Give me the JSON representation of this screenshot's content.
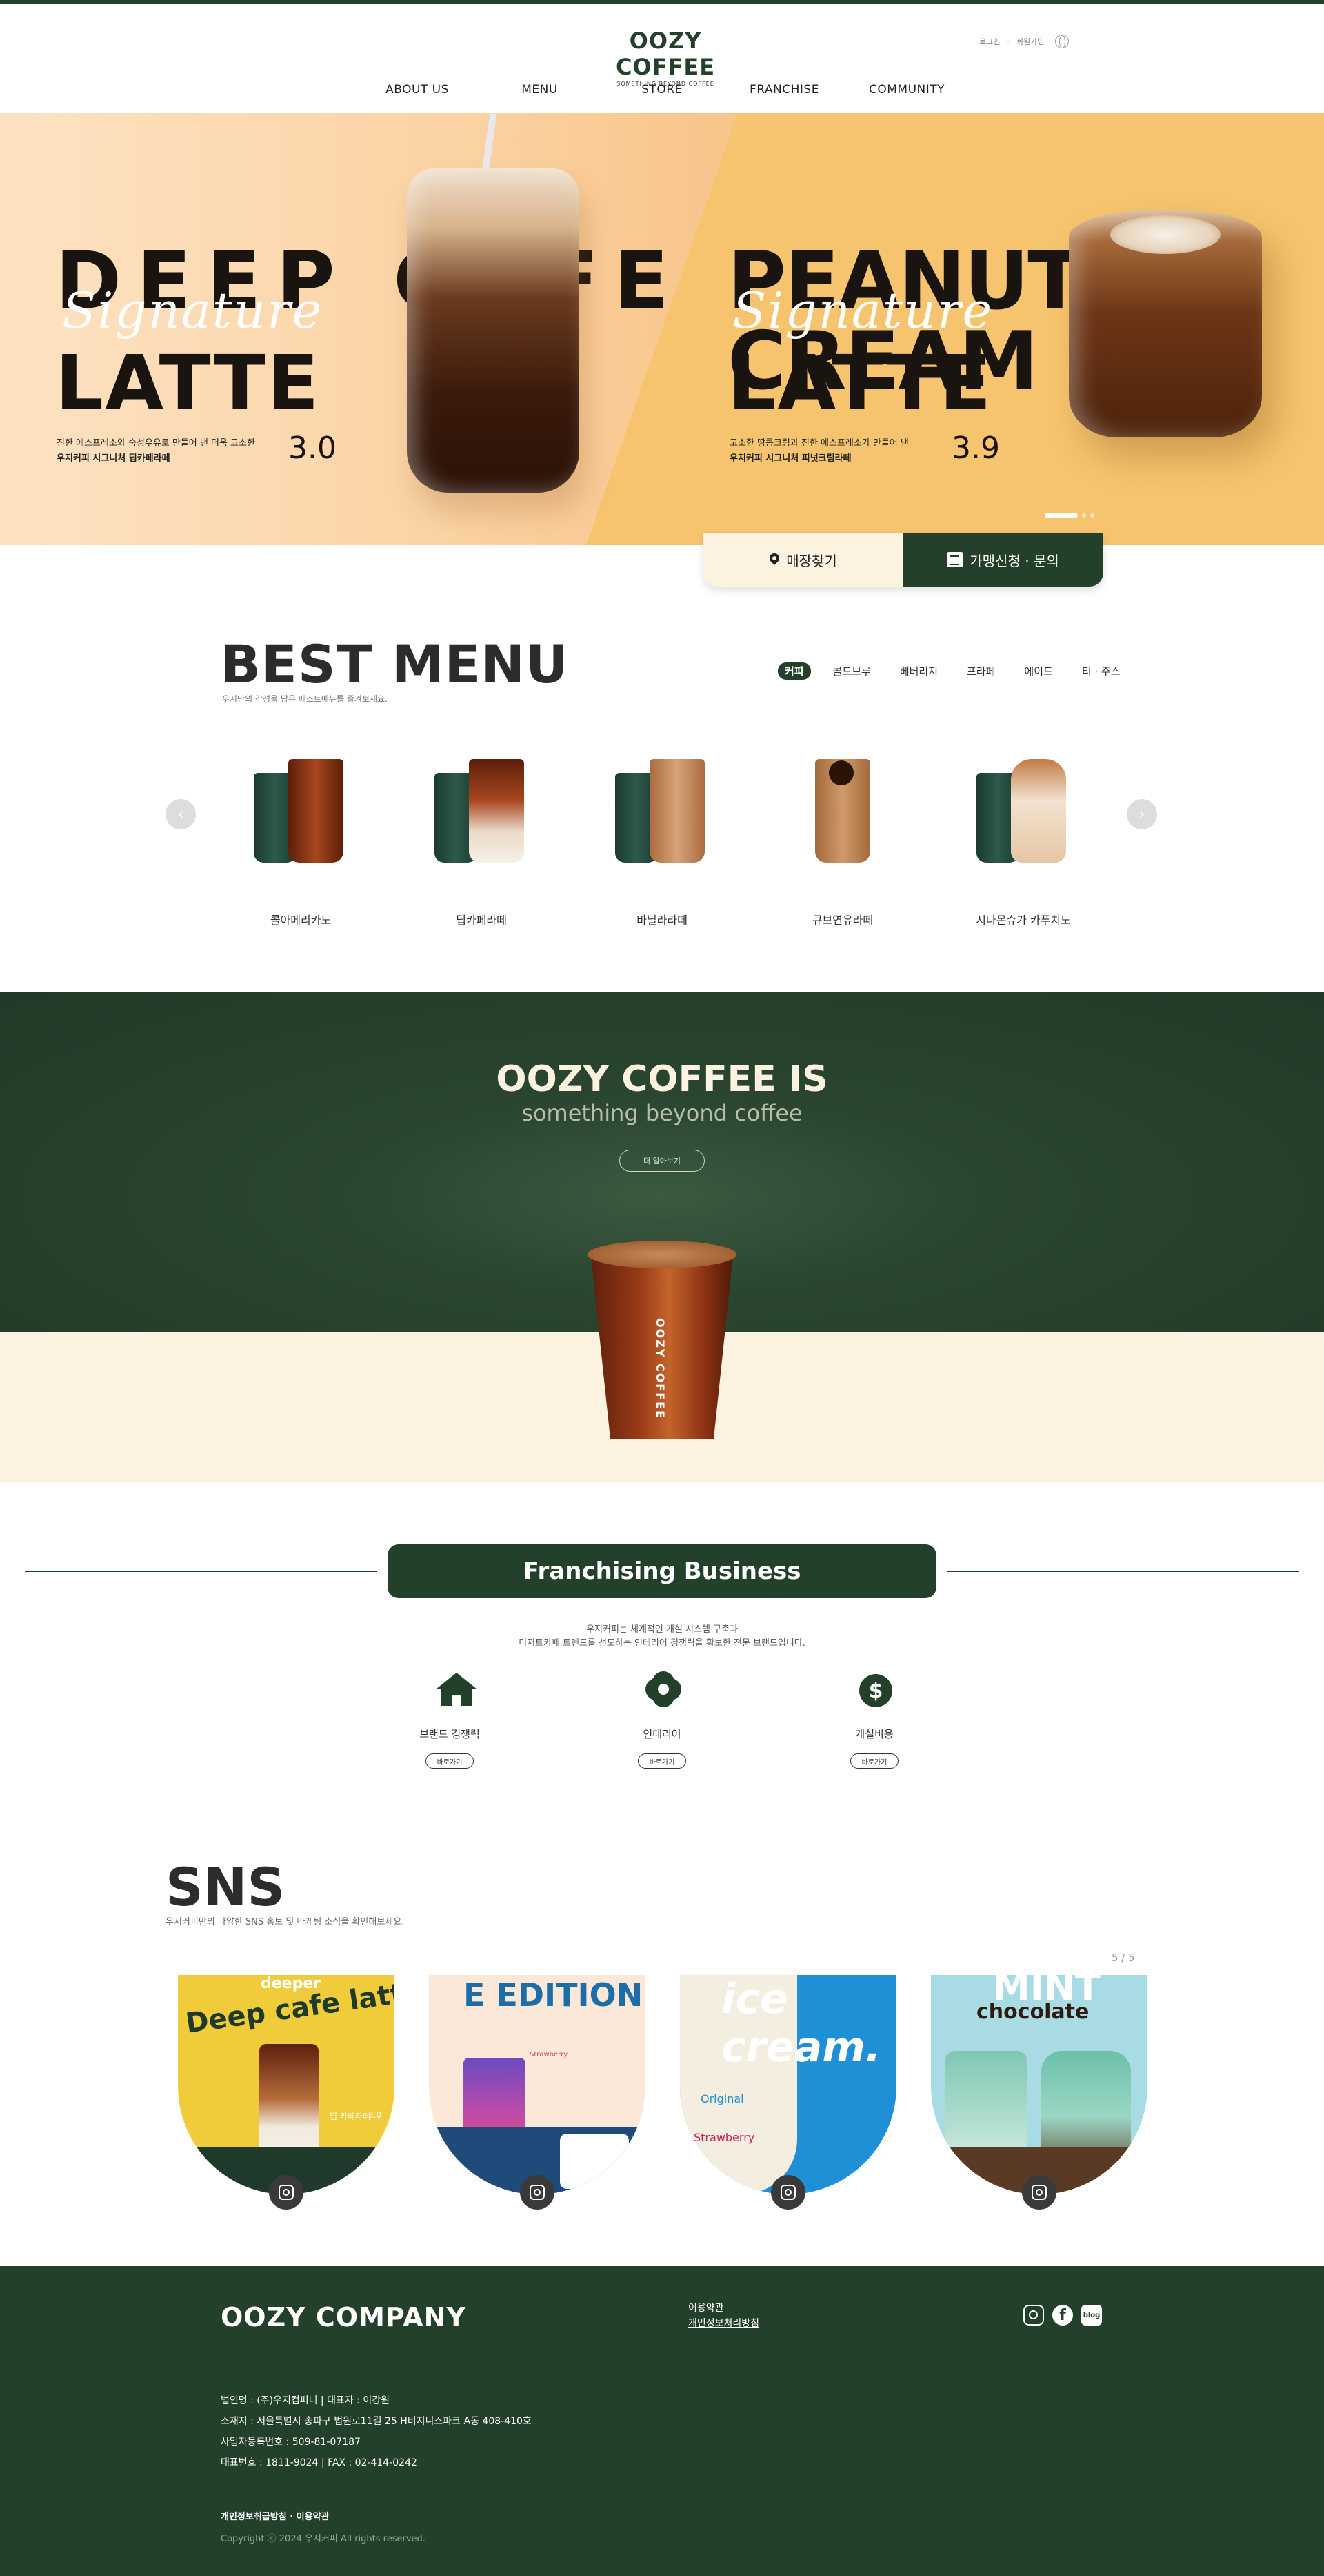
{
  "header": {
    "logo": "OOZY COFFEE",
    "logo_tagline": "SOMETHING BEYOND COFFEE",
    "login": "로그인",
    "join": "회원가입",
    "nav": [
      "ABOUT US",
      "MENU",
      "STORE",
      "FRANCHISE",
      "COMMUNITY"
    ]
  },
  "hero": {
    "slides": [
      {
        "title_line1": "DEEP CAFE",
        "signature": "Signature",
        "title_line2": "LATTE",
        "desc_line1": "진한 에스프레소와 숙성우유로 만들어 낸 더욱 고소한",
        "desc_line2": "우지커피 시그니처 딥카페라떼",
        "price": "3.0"
      },
      {
        "title_line1": "PEANUT CREAM",
        "signature": "Signature",
        "title_line2": "LATTE",
        "desc_line1": "고소한 땅콩크림과 진한 에스프레소가 만들어 낸",
        "desc_line2": "우지커피 시그니처 피넛크림라떼",
        "price": "3.9"
      }
    ],
    "store_button": "매장찾기",
    "franchise_button": "가맹신청 · 문의",
    "accent_color": "#23402a"
  },
  "best_menu": {
    "title": "BEST MENU",
    "subtitle": "우지만의 감성을 담은 베스트메뉴를 즐겨보세요.",
    "tabs": [
      "커피",
      "콜드브루",
      "베버리지",
      "프라페",
      "에이드",
      "티 · 주스"
    ],
    "active_tab": "커피",
    "items": [
      "콜아메리카노",
      "딥카페라떼",
      "바닐라라떼",
      "큐브연유라떼",
      "시나몬슈가 카푸치노"
    ],
    "prev_icon": "‹",
    "next_icon": "›"
  },
  "about": {
    "title": "OOZY COFFEE IS",
    "subtitle": "something beyond coffee",
    "more_button": "더 알아보기",
    "cup_label": "OOZY COFFEE"
  },
  "franchise": {
    "title": "Franchising Business",
    "desc_line1": "우지커피는 체계적인 개설 시스템 구축과",
    "desc_line2": "디저트카페 트렌드를 선도하는 인테리어 경쟁력을 확보한 전문 브랜드입니다.",
    "items": [
      {
        "label": "브랜드 경쟁력",
        "button": "바로가기",
        "icon": "house-icon"
      },
      {
        "label": "인테리어",
        "button": "바로가기",
        "icon": "gear-icon"
      },
      {
        "label": "개설비용",
        "button": "바로가기",
        "icon": "dollar-icon"
      }
    ]
  },
  "sns": {
    "title": "SNS",
    "subtitle": "우지커피만의 다양한 SNS 홍보 및 마케팅 소식을 확인해보세요.",
    "counter": "5 / 5",
    "cards": [
      {
        "text_big": "Deep cafe latte",
        "text_small": "deeper",
        "label": "딥 카페라떼",
        "price": "3.0"
      },
      {
        "text_big": "E EDITION",
        "text_small": "Strawberry",
        "label": "",
        "price": ""
      },
      {
        "text_big": "ice cream.",
        "text_small": "Original",
        "label": "Strawberry",
        "price": ""
      },
      {
        "text_big": "MINT",
        "text_small": "chocolate",
        "label": "",
        "price": ""
      }
    ]
  },
  "footer": {
    "logo": "OOZY COMPANY",
    "link1": "이용약관",
    "link2": "개인정보처리방침",
    "blog": "blog",
    "facebook": "f",
    "info": [
      "법인명 : (주)우지컴퍼니  |  대표자 : 이강원",
      "소재지 : 서울특별시 송파구 법원로11길 25 H비지니스파크 A동 408-410호",
      "사업자등록번호 : 509-81-07187",
      "대표번호 : 1811-9024  |  FAX : 02-414-0242"
    ],
    "policy": "개인정보취급방침 · 이용약관",
    "copyright": "Copyright ⓒ 2024 우지커피 All rights reserved."
  }
}
